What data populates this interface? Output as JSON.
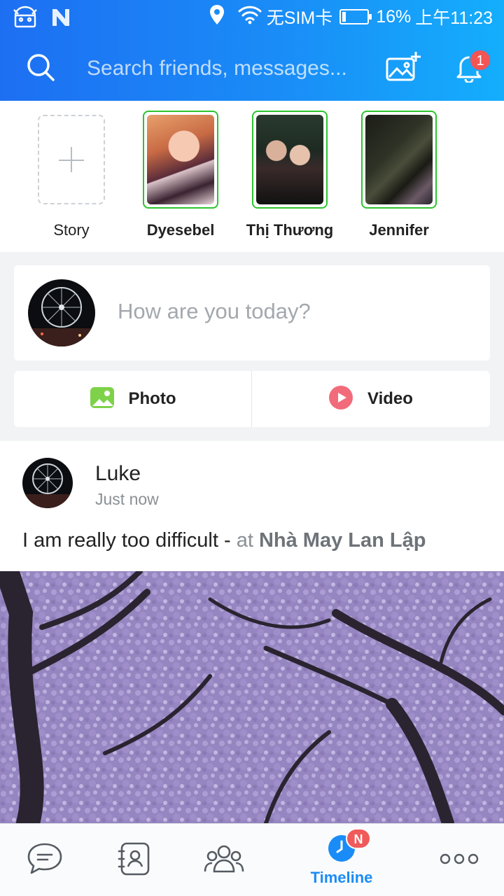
{
  "status_bar": {
    "carrier_text": "无SIM卡",
    "battery": "16%",
    "time": "上午11:23",
    "battery_level": 0.16,
    "icons": [
      "android-debug-icon",
      "n-logo-icon",
      "location-icon",
      "wifi-icon",
      "battery-icon"
    ]
  },
  "header": {
    "search_placeholder": "Search friends, messages...",
    "notification_count": "1"
  },
  "stories": [
    {
      "name": "Story",
      "type": "add"
    },
    {
      "name": "Dyesebel",
      "type": "friend"
    },
    {
      "name": "Thị Thương",
      "type": "friend"
    },
    {
      "name": "Jennifer",
      "type": "friend"
    }
  ],
  "composer": {
    "placeholder": "How are you today?",
    "photo_label": "Photo",
    "video_label": "Video"
  },
  "post": {
    "author": "Luke",
    "time": "Just now",
    "text": "I am really too difficult - ",
    "at": "at ",
    "place": "Nhà May Lan Lập"
  },
  "bottom_nav": {
    "timeline_label": "Timeline",
    "timeline_badge": "N"
  },
  "colors": {
    "accent": "#1a8cf7",
    "story_ring": "#2ec42e",
    "badge": "#f05a5a"
  }
}
